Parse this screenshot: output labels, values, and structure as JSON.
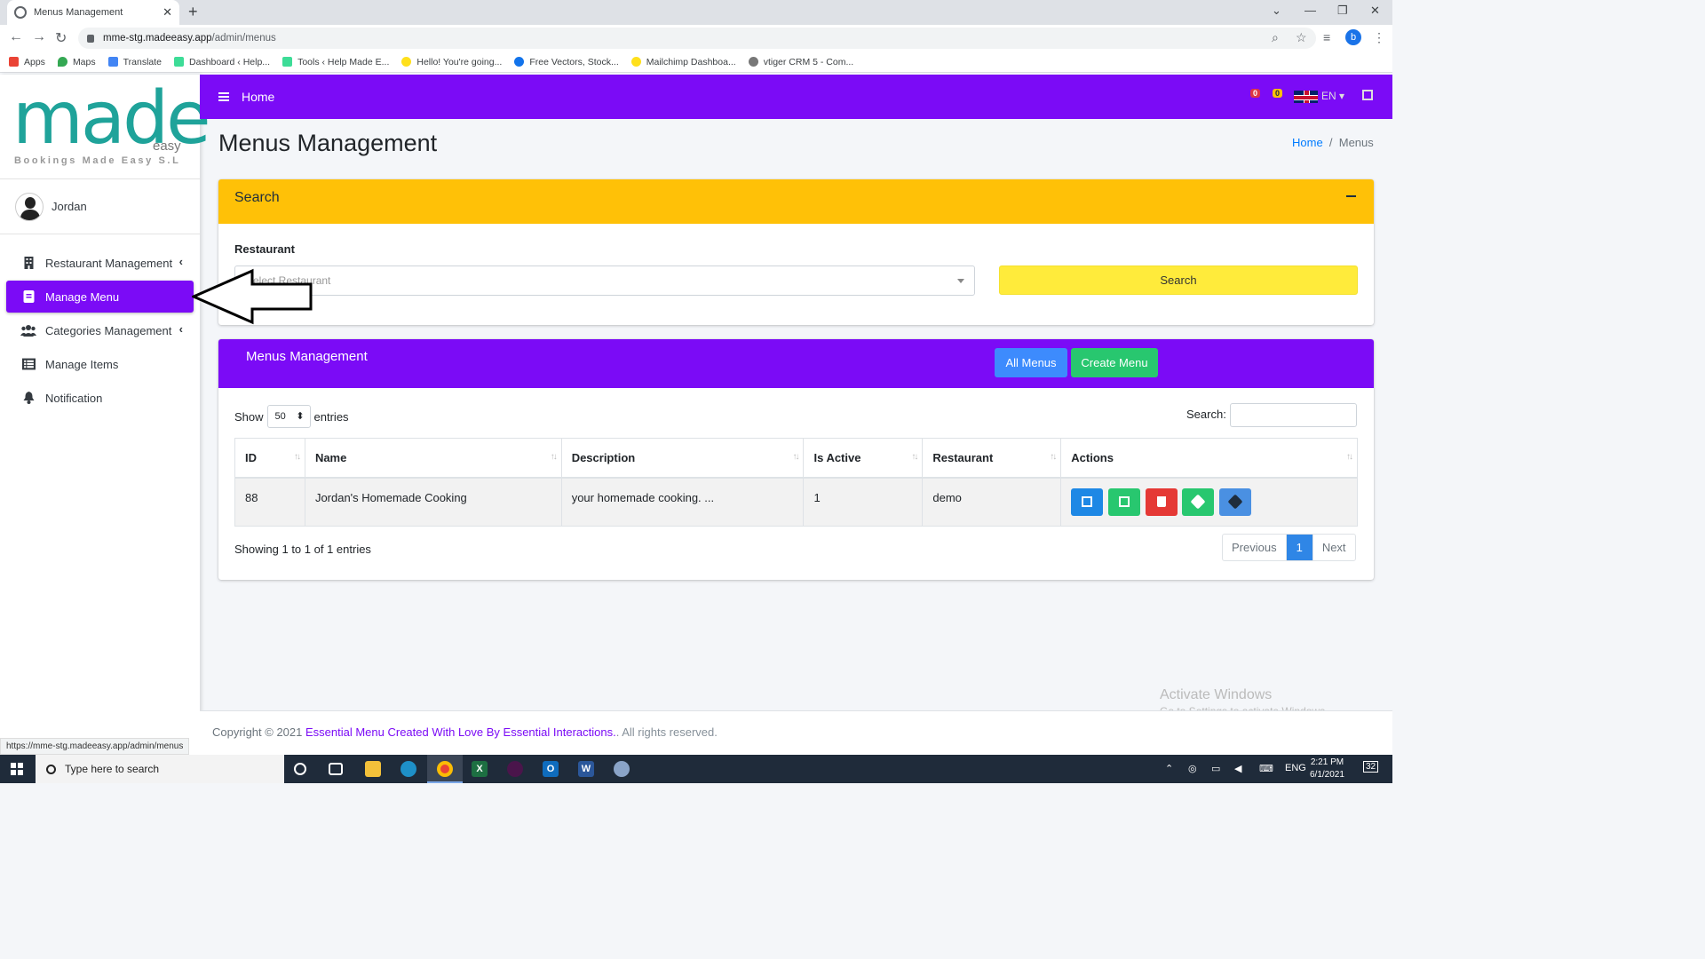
{
  "browser": {
    "tab_title": "Menus Management",
    "url_host": "mme-stg.madeeasy.app",
    "url_path": "/admin/menus",
    "profile_initial": "b",
    "bookmarks": [
      "Apps",
      "Maps",
      "Translate",
      "Dashboard ‹ Help...",
      "Tools ‹ Help Made E...",
      "Hello! You're going...",
      "Free Vectors, Stock...",
      "Mailchimp Dashboa...",
      "vtiger CRM 5 - Com..."
    ],
    "status_url": "https://mme-stg.madeeasy.app/admin/menus"
  },
  "sidebar": {
    "logo_word": "made",
    "logo_sub": "easy",
    "logo_tagline": "Bookings Made Easy S.L",
    "user": "Jordan",
    "items": [
      {
        "label": "Restaurant Management",
        "icon": "building-icon",
        "has_submenu": true
      },
      {
        "label": "Manage Menu",
        "icon": "book-icon",
        "active": true
      },
      {
        "label": "Categories Management",
        "icon": "users-icon",
        "has_submenu": true
      },
      {
        "label": "Manage Items",
        "icon": "list-icon"
      },
      {
        "label": "Notification",
        "icon": "bell-icon"
      }
    ]
  },
  "header": {
    "home_label": "Home",
    "badge_messages": "0",
    "badge_notifications": "0",
    "language": "EN",
    "accent_color": "#7b0bf6"
  },
  "page": {
    "title": "Menus Management",
    "breadcrumb_home": "Home",
    "breadcrumb_current": "Menus"
  },
  "search_card": {
    "title": "Search",
    "restaurant_label": "Restaurant",
    "restaurant_placeholder": "Select Restaurant",
    "search_button": "Search"
  },
  "menus_card": {
    "title": "Menus Management",
    "all_menus_button": "All Menus",
    "create_menu_button": "Create Menu",
    "show_label": "Show",
    "page_length": "50",
    "entries_label": "entries",
    "filter_label": "Search:",
    "columns": [
      "ID",
      "Name",
      "Description",
      "Is Active",
      "Restaurant",
      "Actions"
    ],
    "rows": [
      {
        "id": "88",
        "name": "Jordan's Homemade Cooking",
        "description": "your homemade cooking. ...",
        "is_active": "1",
        "restaurant": "demo"
      }
    ],
    "info": "Showing 1 to 1 of 1 entries",
    "pager": {
      "previous": "Previous",
      "current": "1",
      "next": "Next"
    }
  },
  "watermark": {
    "line1": "Activate Windows",
    "line2": "Go to Settings to activate Windows."
  },
  "footer": {
    "copyright": "Copyright © 2021",
    "link_text": "Essential Menu Created With Love By Essential Interactions.",
    "suffix": ". All rights reserved."
  },
  "taskbar": {
    "search_placeholder": "Type here to search",
    "language": "ENG",
    "time": "2:21 PM",
    "date": "6/1/2021",
    "notification_count": "32"
  }
}
